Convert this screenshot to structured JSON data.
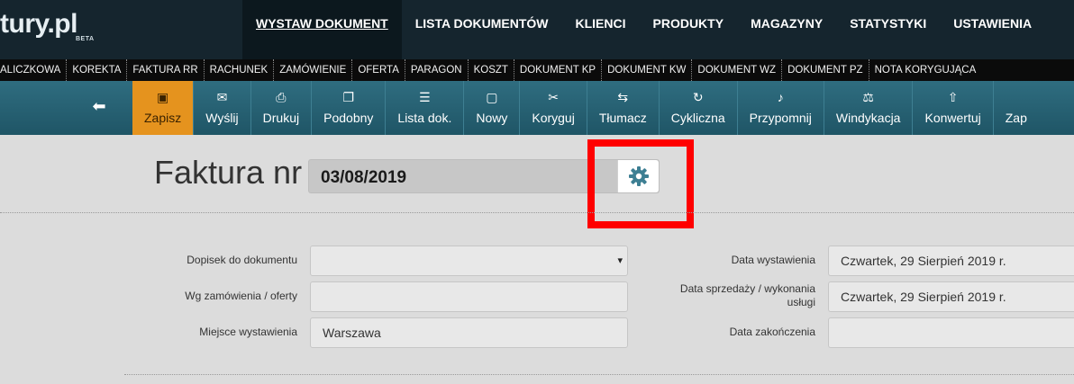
{
  "header": {
    "logo_text": "tury.pl",
    "logo_badge": "BETA",
    "nav": [
      {
        "label": "WYSTAW DOKUMENT",
        "active": true
      },
      {
        "label": "LISTA DOKUMENTÓW"
      },
      {
        "label": "KLIENCI"
      },
      {
        "label": "PRODUKTY"
      },
      {
        "label": "MAGAZYNY"
      },
      {
        "label": "STATYSTYKI"
      },
      {
        "label": "USTAWIENIA"
      }
    ]
  },
  "doc_types": [
    "ALICZKOWA",
    "KOREKTA",
    "FAKTURA RR",
    "RACHUNEK",
    "ZAMÓWIENIE",
    "OFERTA",
    "PARAGON",
    "KOSZT",
    "DOKUMENT KP",
    "DOKUMENT KW",
    "DOKUMENT WZ",
    "DOKUMENT PZ",
    "NOTA KORYGUJĄCA"
  ],
  "toolbar": {
    "back_icon": "arrow-left-icon",
    "tools": [
      {
        "label": "Zapisz",
        "icon": "save-icon",
        "glyph": "▣",
        "active": true
      },
      {
        "label": "Wyślij",
        "icon": "envelope-icon",
        "glyph": "✉"
      },
      {
        "label": "Drukuj",
        "icon": "print-icon",
        "glyph": "⎙"
      },
      {
        "label": "Podobny",
        "icon": "copy-icon",
        "glyph": "❐"
      },
      {
        "label": "Lista dok.",
        "icon": "list-icon",
        "glyph": "☰"
      },
      {
        "label": "Nowy",
        "icon": "new-file-icon",
        "glyph": "▢"
      },
      {
        "label": "Koryguj",
        "icon": "wrench-icon",
        "glyph": "✂"
      },
      {
        "label": "Tłumacz",
        "icon": "exchange-icon",
        "glyph": "⇆"
      },
      {
        "label": "Cykliczna",
        "icon": "refresh-icon",
        "glyph": "↻"
      },
      {
        "label": "Przypomnij",
        "icon": "bell-icon",
        "glyph": "♪"
      },
      {
        "label": "Windykacja",
        "icon": "gavel-icon",
        "glyph": "⚖"
      },
      {
        "label": "Konwertuj",
        "icon": "upload-icon",
        "glyph": "⇧"
      },
      {
        "label": "Zap",
        "icon": "partial-icon",
        "glyph": ""
      }
    ]
  },
  "document": {
    "title": "Faktura nr",
    "number": "03/08/2019",
    "settings_icon": "gear-icon"
  },
  "form": {
    "dopisek_label": "Dopisek do dokumentu",
    "dopisek_value": "",
    "wg_zamowienia_label": "Wg zamówienia / oferty",
    "wg_zamowienia_value": "",
    "miejsce_label": "Miejsce wystawienia",
    "miejsce_value": "Warszawa",
    "data_wystawienia_label": "Data wystawienia",
    "data_wystawienia_value": "Czwartek, 29 Sierpień 2019 r.",
    "data_sprzedazy_label_line1": "Data sprzedaży / wykonania",
    "data_sprzedazy_label_line2": "usługi",
    "data_sprzedazy_value": "Czwartek, 29 Sierpień 2019 r.",
    "data_zakonczenia_label": "Data zakończenia",
    "data_zakonczenia_value": ""
  }
}
